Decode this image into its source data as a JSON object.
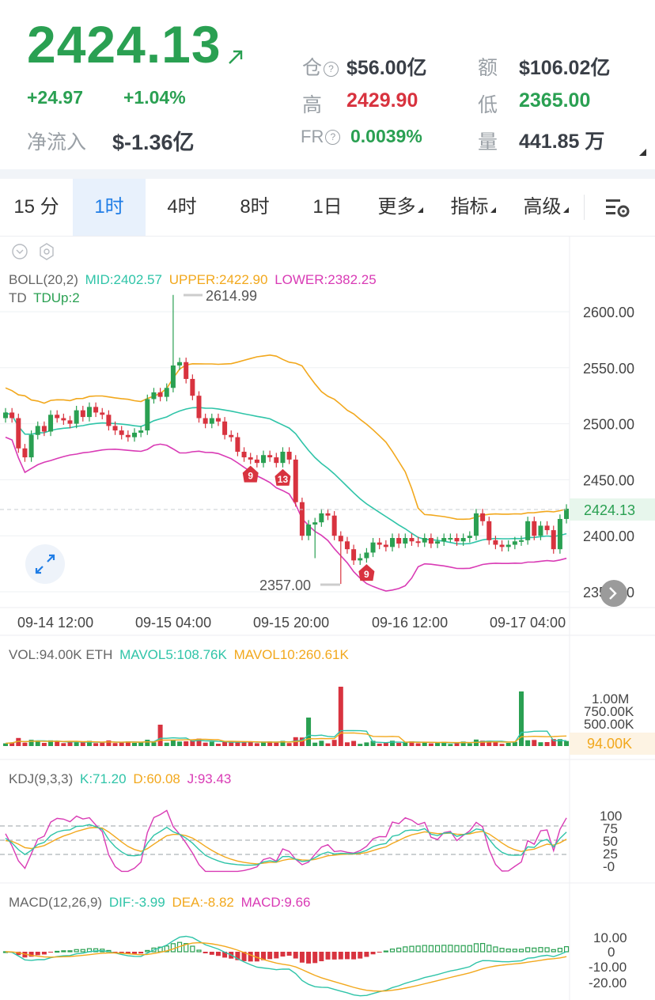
{
  "header": {
    "price": "2424.13",
    "change_abs": "+24.97",
    "change_pct": "+1.04%",
    "netflow_label": "净流入",
    "netflow_value": "$-1.36亿",
    "stats": {
      "position_label": "仓",
      "position_value": "$56.00亿",
      "amount_label": "额",
      "amount_value": "$106.02亿",
      "high_label": "高",
      "high_value": "2429.90",
      "low_label": "低",
      "low_value": "2365.00",
      "fr_label": "FR",
      "fr_value": "0.0039%",
      "volume_label": "量",
      "volume_value": "441.85 万"
    },
    "help_glyph": "?"
  },
  "toolbar": {
    "tabs": [
      "15 分",
      "1时",
      "4时",
      "8时",
      "1日",
      "更多",
      "指标",
      "高级"
    ],
    "active_index": 1
  },
  "colors": {
    "up": "#2aa052",
    "down": "#d8333f",
    "mid": "#2fc4a8",
    "upper": "#f2a81d",
    "lower": "#d93bb5",
    "accent": "#1f7de6"
  },
  "chart_data": [
    {
      "type": "candlestick",
      "indicator": {
        "name": "BOLL(20,2)",
        "mid": "MID:2402.57",
        "upper": "UPPER:2422.90",
        "lower": "LOWER:2382.25"
      },
      "td": {
        "name": "TD",
        "value": "TDUp:2"
      },
      "y_ticks": [
        "2600.00",
        "2550.00",
        "2500.00",
        "2450.00",
        "2400.00",
        "2350.00"
      ],
      "ylim": [
        2340,
        2630
      ],
      "last_price": "2424.13",
      "max_label": "2614.99",
      "min_label": "2357.00",
      "td_markers": [
        "9",
        "13",
        "9"
      ],
      "x_ticks": [
        "09-14 12:00",
        "09-15 04:00",
        "09-15 20:00",
        "09-16 12:00",
        "09-17 04:00"
      ],
      "closes": [
        2510,
        2505,
        2478,
        2470,
        2490,
        2498,
        2493,
        2508,
        2505,
        2503,
        2500,
        2512,
        2506,
        2515,
        2510,
        2508,
        2498,
        2494,
        2490,
        2488,
        2492,
        2494,
        2522,
        2528,
        2524,
        2532,
        2552,
        2555,
        2540,
        2525,
        2505,
        2500,
        2505,
        2502,
        2490,
        2488,
        2475,
        2470,
        2468,
        2465,
        2472,
        2470,
        2465,
        2475,
        2468,
        2430,
        2400,
        2410,
        2412,
        2420,
        2418,
        2400,
        2395,
        2388,
        2378,
        2380,
        2385,
        2394,
        2392,
        2390,
        2398,
        2393,
        2398,
        2395,
        2394,
        2398,
        2393,
        2395,
        2398,
        2398,
        2395,
        2398,
        2400,
        2420,
        2413,
        2396,
        2392,
        2390,
        2392,
        2395,
        2396,
        2413,
        2400,
        2409,
        2405,
        2388,
        2415,
        2424.13
      ],
      "opens": [
        2505,
        2510,
        2505,
        2478,
        2470,
        2490,
        2498,
        2493,
        2508,
        2505,
        2503,
        2500,
        2512,
        2506,
        2515,
        2510,
        2508,
        2498,
        2494,
        2490,
        2488,
        2492,
        2494,
        2522,
        2528,
        2524,
        2532,
        2552,
        2555,
        2540,
        2525,
        2505,
        2500,
        2505,
        2502,
        2490,
        2488,
        2475,
        2470,
        2468,
        2465,
        2472,
        2470,
        2465,
        2475,
        2468,
        2430,
        2400,
        2410,
        2412,
        2420,
        2418,
        2400,
        2395,
        2388,
        2378,
        2380,
        2385,
        2394,
        2392,
        2390,
        2398,
        2393,
        2398,
        2395,
        2394,
        2398,
        2393,
        2395,
        2398,
        2398,
        2395,
        2398,
        2400,
        2420,
        2413,
        2396,
        2392,
        2390,
        2392,
        2395,
        2396,
        2413,
        2400,
        2409,
        2405,
        2388,
        2415
      ]
    },
    {
      "type": "bar",
      "indicator": "VOL:94.00K ETH",
      "mavol5": "MAVOL5:108.76K",
      "mavol10": "MAVOL10:260.61K",
      "y_ticks": [
        "1.00M",
        "750.00K",
        "500.00K"
      ],
      "last_value_label": "94.00K"
    },
    {
      "type": "line",
      "indicator": "KDJ(9,3,3)",
      "k": "K:71.20",
      "d": "D:60.08",
      "j": "J:93.43",
      "y_ticks": [
        "100",
        "75",
        "50",
        "25",
        "-0"
      ]
    },
    {
      "type": "bar",
      "indicator": "MACD(12,26,9)",
      "dif": "DIF:-3.99",
      "dea": "DEA:-8.82",
      "macd": "MACD:9.66",
      "y_ticks": [
        "10.00",
        "0",
        "-10.00",
        "-20.00"
      ]
    }
  ]
}
